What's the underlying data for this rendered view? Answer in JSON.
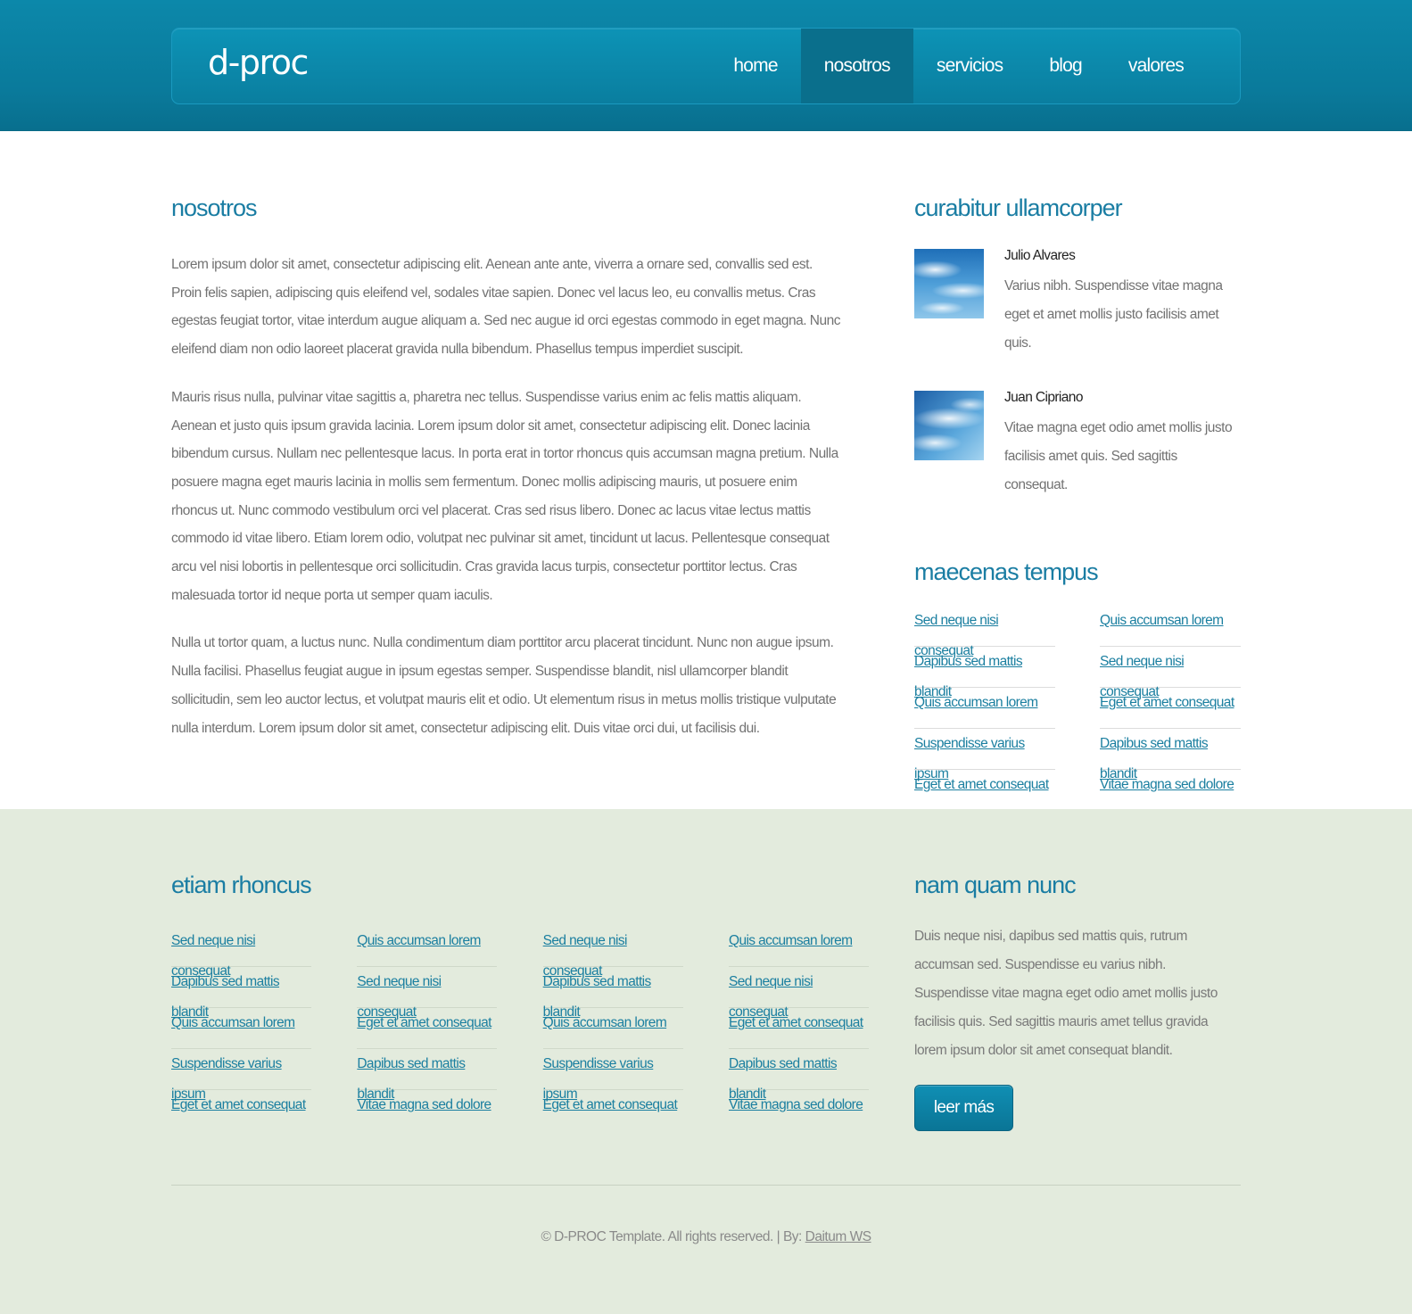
{
  "header": {
    "logo": "d-proc",
    "menu": [
      "home",
      "nosotros",
      "servicios",
      "blog",
      "valores"
    ],
    "active_index": 1
  },
  "main": {
    "title": "nosotros",
    "paragraphs": [
      "Lorem ipsum dolor sit amet, consectetur adipiscing elit. Aenean ante ante, viverra a ornare sed, convallis sed est. Proin felis sapien, adipiscing quis eleifend vel, sodales vitae sapien. Donec vel lacus leo, eu convallis metus. Cras egestas feugiat tortor, vitae interdum augue aliquam a. Sed nec augue id orci egestas commodo in eget magna. Nunc eleifend diam non odio laoreet placerat gravida nulla bibendum. Phasellus tempus imperdiet suscipit.",
      "Mauris risus nulla, pulvinar vitae sagittis a, pharetra nec tellus. Suspendisse varius enim ac felis mattis aliquam. Aenean et justo quis ipsum gravida lacinia. Lorem ipsum dolor sit amet, consectetur adipiscing elit. Donec lacinia bibendum cursus. Nullam nec pellentesque lacus. In porta erat in tortor rhoncus quis accumsan magna pretium. Nulla posuere magna eget mauris lacinia in mollis sem fermentum. Donec mollis adipiscing mauris, ut posuere enim rhoncus ut. Nunc commodo vestibulum orci vel placerat. Cras sed risus libero. Donec ac lacus vitae lectus mattis commodo id vitae libero. Etiam lorem odio, volutpat nec pulvinar sit amet, tincidunt ut lacus. Pellentesque consequat arcu vel nisi lobortis in pellentesque orci sollicitudin. Cras gravida lacus turpis, consectetur porttitor lectus. Cras malesuada tortor id neque porta ut semper quam iaculis.",
      "Nulla ut tortor quam, a luctus nunc. Nulla condimentum diam porttitor arcu placerat tincidunt. Nunc non augue ipsum. Nulla facilisi. Phasellus feugiat augue in ipsum egestas semper. Suspendisse blandit, nisl ullamcorper blandit sollicitudin, sem leo auctor lectus, et volutpat mauris elit et odio. Ut elementum risus in metus mollis tristique vulputate nulla interdum. Lorem ipsum dolor sit amet, consectetur adipiscing elit. Duis vitae orci dui, ut facilisis dui."
    ]
  },
  "sidebar": {
    "testimonials_title": "curabitur ullamcorper",
    "testimonials": [
      {
        "name": "Julio Alvares",
        "quote": "Varius nibh. Suspendisse vitae magna eget et amet mollis justo facilisis amet quis."
      },
      {
        "name": "Juan Cipriano",
        "quote": "Vitae magna eget odio amet mollis justo facilisis amet quis. Sed sagittis consequat."
      }
    ],
    "links_title": "maecenas tempus",
    "links_col1": [
      "Sed neque nisi consequat",
      "Dapibus sed mattis blandit",
      "Quis accumsan lorem",
      "Suspendisse varius ipsum",
      "Eget et amet consequat"
    ],
    "links_col2": [
      "Quis accumsan lorem",
      "Sed neque nisi consequat",
      "Eget et amet consequat",
      "Dapibus sed mattis blandit",
      "Vitae magna sed dolore"
    ]
  },
  "footer": {
    "links_title": "etiam rhoncus",
    "columns": [
      [
        "Sed neque nisi consequat",
        "Dapibus sed mattis blandit",
        "Quis accumsan lorem",
        "Suspendisse varius ipsum",
        "Eget et amet consequat"
      ],
      [
        "Quis accumsan lorem",
        "Sed neque nisi consequat",
        "Eget et amet consequat",
        "Dapibus sed mattis blandit",
        "Vitae magna sed dolore"
      ],
      [
        "Sed neque nisi consequat",
        "Dapibus sed mattis blandit",
        "Quis accumsan lorem",
        "Suspendisse varius ipsum",
        "Eget et amet consequat"
      ],
      [
        "Quis accumsan lorem",
        "Sed neque nisi consequat",
        "Eget et amet consequat",
        "Dapibus sed mattis blandit",
        "Vitae magna sed dolore"
      ]
    ],
    "about_title": "nam quam nunc",
    "about_text": "Duis neque nisi, dapibus sed mattis quis, rutrum accumsan sed. Suspendisse eu varius nibh. Suspendisse vitae magna eget odio amet mollis justo facilisis quis. Sed sagittis mauris amet tellus gravida lorem ipsum dolor sit amet consequat blandit.",
    "button_label": "leer más",
    "copyright_text": "© D-PROC Template. All rights reserved. | By: ",
    "copyright_link": "Daitum WS"
  },
  "colors": {
    "header_blue": "#0a7e9f",
    "heading_blue": "#1a7da3",
    "link_blue": "#1b7fa0",
    "footer_bg": "#e3ebdd"
  }
}
